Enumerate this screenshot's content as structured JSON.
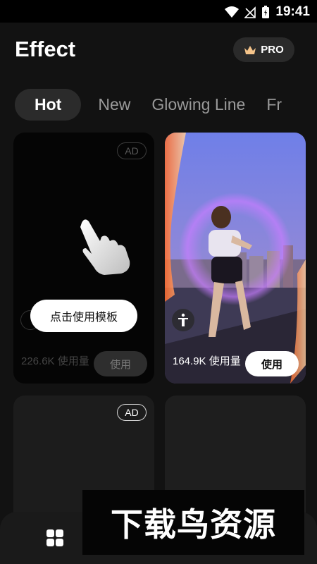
{
  "status_bar": {
    "time": "19:41"
  },
  "header": {
    "title": "Effect",
    "pro_label": "PRO"
  },
  "tabs": [
    {
      "label": "Hot",
      "active": true
    },
    {
      "label": "New",
      "active": false
    },
    {
      "label": "Glowing Line",
      "active": false
    },
    {
      "label": "Fr",
      "active": false
    }
  ],
  "cards": [
    {
      "ad": "AD",
      "count_text": "226.6K 使用量",
      "use_label": "使用",
      "tooltip": "点击使用模板"
    },
    {
      "count_text": "164.9K 使用量",
      "use_label": "使用"
    },
    {
      "ad": "AD"
    },
    {}
  ],
  "watermark": "下载鸟资源",
  "colors": {
    "background": "#121212",
    "card": "#1c1c1c",
    "accent_crown": "#f5c48a"
  }
}
